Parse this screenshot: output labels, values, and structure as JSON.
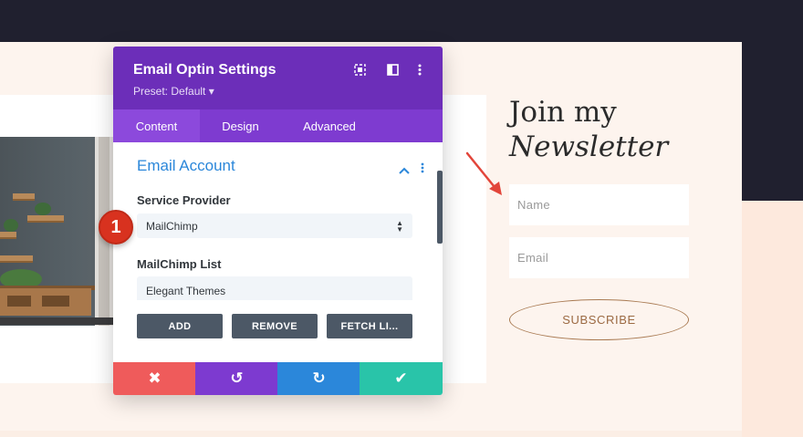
{
  "modal": {
    "title": "Email Optin Settings",
    "preset": "Preset: Default ▾",
    "header_icons": [
      "target-icon",
      "split-view-icon",
      "more-vertical-icon"
    ],
    "tabs": [
      {
        "label": "Content",
        "active": true
      },
      {
        "label": "Design",
        "active": false
      },
      {
        "label": "Advanced",
        "active": false
      }
    ],
    "section": {
      "title": "Email Account",
      "collapse_glyph": "⌃",
      "menu_glyph": "⋮"
    },
    "service_provider": {
      "label": "Service Provider",
      "value": "MailChimp"
    },
    "mailchimp_list": {
      "label": "MailChimp List",
      "value": "Elegant Themes"
    },
    "buttons": {
      "add": "ADD",
      "remove": "REMOVE",
      "fetch": "FETCH LI..."
    },
    "footer": {
      "cancel": "✖",
      "undo": "↺",
      "redo": "↻",
      "save": "✔"
    },
    "colors": {
      "header": "#6c2eb9",
      "tabs": "#7e3bd0",
      "cancel": "#ef5b5b",
      "undo": "#7d3ad0",
      "redo": "#2b87da",
      "save": "#29c4a9"
    }
  },
  "badge": {
    "number": "1"
  },
  "newsletter": {
    "title_line1": "Join my",
    "title_line2": "Newsletter",
    "name_placeholder": "Name",
    "email_placeholder": "Email",
    "subscribe_label": "SUBSCRIBE"
  }
}
